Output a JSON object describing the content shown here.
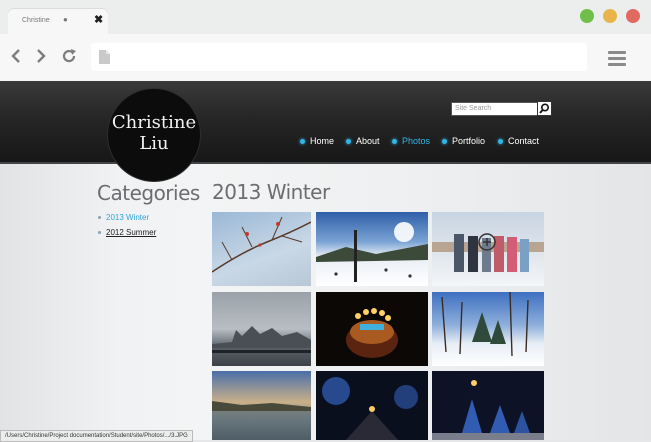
{
  "browser": {
    "tab_title": "Christine",
    "tab_dot": "●",
    "tab_close": "✖",
    "window_buttons": [
      "#6fbf4a",
      "#e9b44c",
      "#e06a5f"
    ]
  },
  "site": {
    "logo_line1": "Christine",
    "logo_line2": "Liu",
    "search_placeholder": "Site Search",
    "nav": [
      "Home",
      "About",
      "Photos",
      "Portfolio",
      "Contact"
    ],
    "active_nav": "Photos",
    "accent_color": "#33b5e5"
  },
  "sidebar": {
    "title": "Categories",
    "items": [
      "2013 Winter",
      "2012 Summer"
    ]
  },
  "main": {
    "title": "2013 Winter",
    "photos": [
      "branch-with-berries",
      "ski-slope-sunlight",
      "group-in-snow",
      "harbour-skyline",
      "birthday-candles",
      "snowy-forest",
      "sunset-over-water",
      "night-lights-street",
      "christmas-trees-night"
    ]
  },
  "status_bar": "/Users/Christine/Project documentation/Student/site/Photos/.../3.JPG"
}
